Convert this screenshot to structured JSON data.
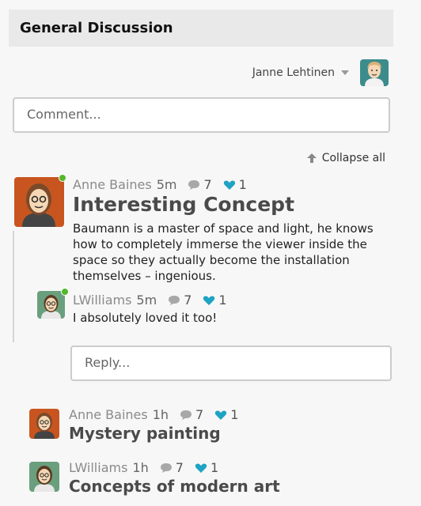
{
  "header": {
    "title": "General Discussion"
  },
  "user": {
    "name": "Janne Lehtinen"
  },
  "comment_input": {
    "placeholder": "Comment..."
  },
  "collapse_label": "Collapse all",
  "posts": [
    {
      "author": "Anne Baines",
      "time": "5m",
      "comments": "7",
      "likes": "1",
      "title": "Interesting Concept",
      "body": "Baumann is a master of space and light, he knows how to completely immerse the viewer inside the space so they actually become the installation themselves – ingenious.",
      "reply": {
        "author": "LWilliams",
        "time": "5m",
        "comments": "7",
        "likes": "1",
        "body": "I absolutely loved it too!"
      }
    },
    {
      "author": "Anne Baines",
      "time": "1h",
      "comments": "7",
      "likes": "1",
      "title": "Mystery painting"
    },
    {
      "author": "LWilliams",
      "time": "1h",
      "comments": "7",
      "likes": "1",
      "title": "Concepts of modern art"
    }
  ],
  "reply_input": {
    "placeholder": "Reply..."
  },
  "colors": {
    "online": "#53b829",
    "heart": "#1fa3c4",
    "bubble": "#a8a8a8"
  }
}
